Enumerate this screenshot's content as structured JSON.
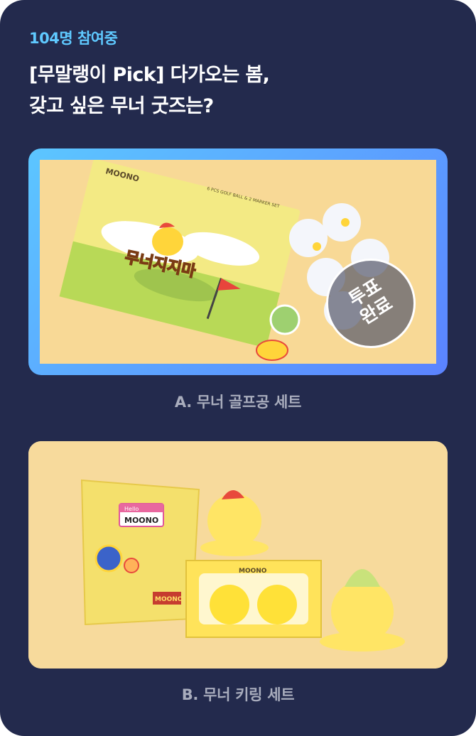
{
  "poll": {
    "participants": "104명 참여중",
    "question_line1": "[무말랭이 Pick] 다가오는 봄,",
    "question_line2": "갖고 싶은 무너 굿즈는?"
  },
  "options": [
    {
      "caption": "A.  무너 골프공 세트",
      "selected": true,
      "badge_line1": "투표",
      "badge_line2": "완료",
      "image": {
        "brand": "MOONO",
        "box_subtitle": "6 PCS GOLF BALL & 2 MARKER SET",
        "box_logo": "무너지지마"
      }
    },
    {
      "caption": "B.  무너 키링 세트",
      "selected": false,
      "image": {
        "brand": "MOONO",
        "tag_hello": "Hello",
        "tag_name": "MOONO",
        "sticker": "MOONO"
      }
    }
  ],
  "colors": {
    "background": "#232a4d",
    "accent": "#5fc9ff",
    "selected_border_start": "#5cc6ff",
    "selected_border_end": "#5b83ff"
  }
}
